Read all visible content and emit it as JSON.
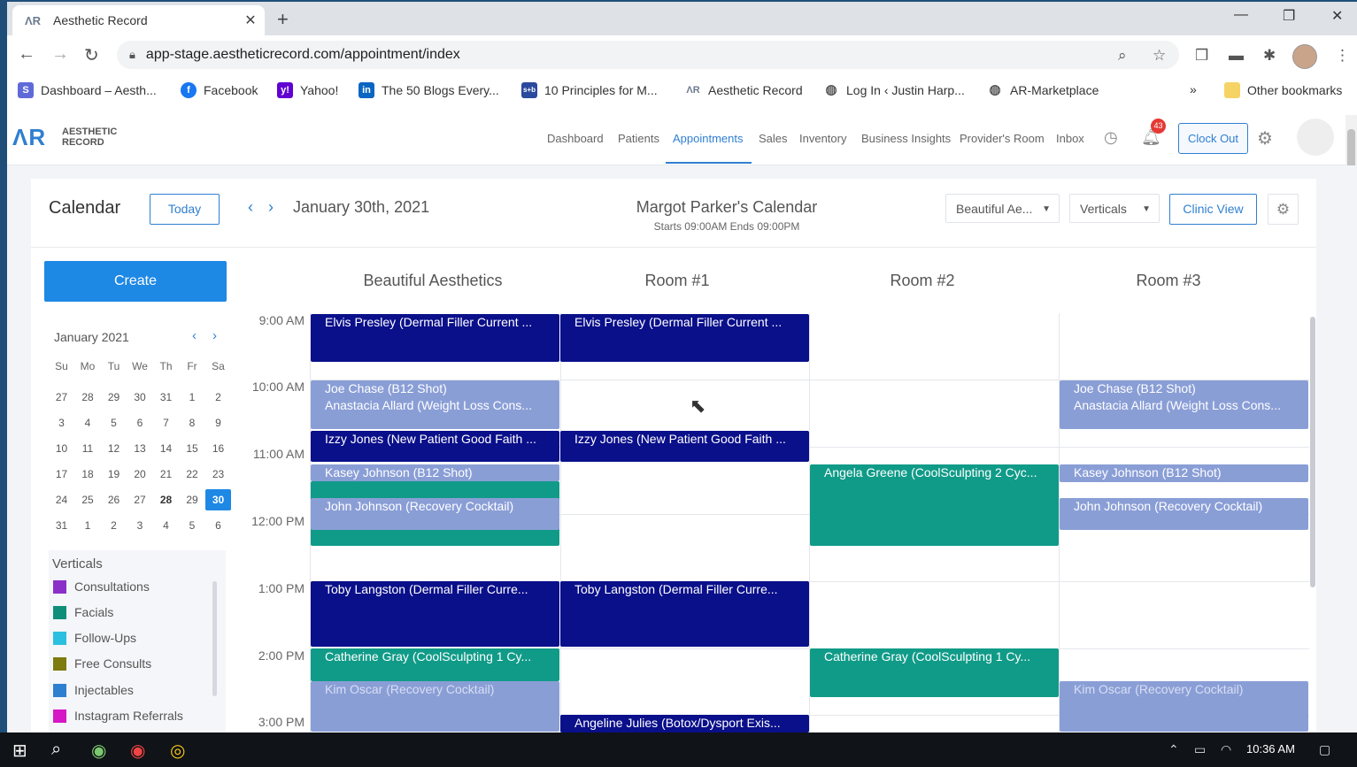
{
  "browser": {
    "tab_title": "Aesthetic Record",
    "tab_favicon": "ΛR",
    "url": "app-stage.aestheticrecord.com/appointment/index",
    "bookmarks": [
      {
        "label": "Dashboard – Aesth...",
        "icon": "S",
        "color": "#5f6ad8"
      },
      {
        "label": "Facebook",
        "icon": "f",
        "color": "#1877f2"
      },
      {
        "label": "Yahoo!",
        "icon": "y!",
        "color": "#6001d2"
      },
      {
        "label": "The 50 Blogs Every...",
        "icon": "in",
        "color": "#0a66c2"
      },
      {
        "label": "10 Principles for M...",
        "icon": "s+b",
        "color": "#2b4a9e"
      },
      {
        "label": "Aesthetic Record",
        "icon": "ΛR",
        "color": "#ffffff"
      },
      {
        "label": "Log In ‹ Justin Harp...",
        "icon": "◍",
        "color": "#ffffff"
      },
      {
        "label": "AR-Marketplace",
        "icon": "◍",
        "color": "#ffffff"
      }
    ],
    "more_bookmarks": "»",
    "other_bookmarks": "Other bookmarks"
  },
  "app": {
    "logo_mark": "ΛR",
    "logo_line1": "AESTHETIC",
    "logo_line2": "RECORD",
    "nav": [
      "Dashboard",
      "Patients",
      "Appointments",
      "Sales",
      "Inventory",
      "Business Insights",
      "Provider's Room",
      "Inbox"
    ],
    "notification_count": "43",
    "clock_out": "Clock Out"
  },
  "calendar": {
    "title": "Calendar",
    "today": "Today",
    "date": "January 30th, 2021",
    "owner": "Margot Parker's Calendar",
    "hours": "Starts 09:00AM  Ends 09:00PM",
    "clinic_select": "Beautiful Ae...",
    "verticals_select": "Verticals",
    "clinic_view": "Clinic View",
    "create": "Create",
    "mini_month": "January 2021",
    "weekdays": [
      "Su",
      "Mo",
      "Tu",
      "We",
      "Th",
      "Fr",
      "Sa"
    ],
    "weeks": [
      [
        "27",
        "28",
        "29",
        "30",
        "31",
        "1",
        "2"
      ],
      [
        "3",
        "4",
        "5",
        "6",
        "7",
        "8",
        "9"
      ],
      [
        "10",
        "11",
        "12",
        "13",
        "14",
        "15",
        "16"
      ],
      [
        "17",
        "18",
        "19",
        "20",
        "21",
        "22",
        "23"
      ],
      [
        "24",
        "25",
        "26",
        "27",
        "28",
        "29",
        "30"
      ],
      [
        "31",
        "1",
        "2",
        "3",
        "4",
        "5",
        "6"
      ]
    ],
    "selected_day": "30",
    "verticals_title": "Verticals",
    "verticals": [
      {
        "label": "Consultations",
        "color": "#8b2fc9"
      },
      {
        "label": "Facials",
        "color": "#0f8f7a"
      },
      {
        "label": "Follow-Ups",
        "color": "#2bc0e0"
      },
      {
        "label": "Free Consults",
        "color": "#7d7a10"
      },
      {
        "label": "Injectables",
        "color": "#2f7fd1"
      },
      {
        "label": "Instagram Referrals",
        "color": "#d617c6"
      }
    ],
    "rooms": [
      "Beautiful Aesthetics",
      "Room #1",
      "Room #2",
      "Room #3"
    ],
    "times": [
      "9:00 AM",
      "10:00 AM",
      "11:00 AM",
      "12:00 PM",
      "1:00 PM",
      "2:00 PM",
      "3:00 PM"
    ],
    "events": {
      "elvis": "Elvis Presley (Dermal Filler Current ...",
      "joe": "Joe Chase (B12 Shot)",
      "anastacia": "Anastacia Allard (Weight Loss Cons...",
      "izzy": "Izzy Jones (New Patient Good Faith ...",
      "kasey": "Kasey Johnson (B12 Shot)",
      "john": "John Johnson (Recovery Cocktail)",
      "angela": "Angela Greene (CoolSculpting 2 Cyc...",
      "toby": "Toby Langston (Dermal Filler Curre...",
      "catherine": "Catherine Gray (CoolSculpting 1 Cy...",
      "kim": "Kim Oscar (Recovery Cocktail)",
      "angeline": "Angeline Julies (Botox/Dysport Exis..."
    }
  },
  "taskbar": {
    "time": "10:36 AM"
  }
}
